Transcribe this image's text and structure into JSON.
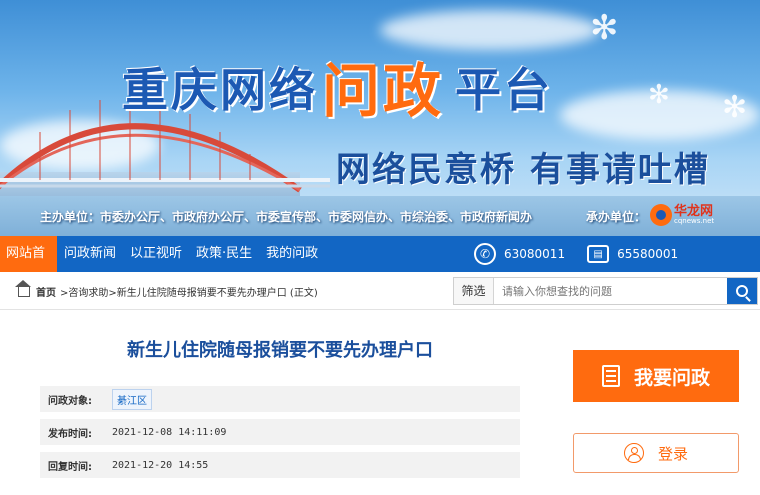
{
  "banner": {
    "title_main": "重庆网络",
    "title_accent": "问政",
    "title_tail": "平台",
    "slogan": "网络民意桥   有事请吐槽",
    "sponsors": "主办单位：市委办公厅、市政府办公厅、市委宣传部、市委网信办、市综治委、市政府新闻办",
    "coop": "承办单位：",
    "logo_cn": "华龙网",
    "logo_en": "cqnews.net"
  },
  "nav": {
    "items": [
      "网站首页",
      "问政新闻",
      "以正视听",
      "政策·民生",
      "我的问政"
    ],
    "phone": "63080011",
    "fax": "65580001"
  },
  "breadcrumb": {
    "home": "首页",
    "path": ">咨询求助>新生儿住院随母报销要不要先办理户口 (正文)"
  },
  "search": {
    "filter_label": "筛选",
    "placeholder": "请输入你想查找的问题"
  },
  "article": {
    "title": "新生儿住院随母报销要不要先办理户口",
    "target_label": "问政对象:",
    "target_value": "綦江区",
    "publish_label": "发布时间:",
    "publish_value": "2021-12-08 14:11:09",
    "reply_label": "回复时间:",
    "reply_value": "2021-12-20 14:55"
  },
  "sidebar": {
    "ask_label": "我要问政",
    "login_label": "登录"
  },
  "colors": {
    "brand_blue": "#1266c4",
    "accent_orange": "#ff6b0f",
    "title_blue": "#1b4f9c"
  }
}
